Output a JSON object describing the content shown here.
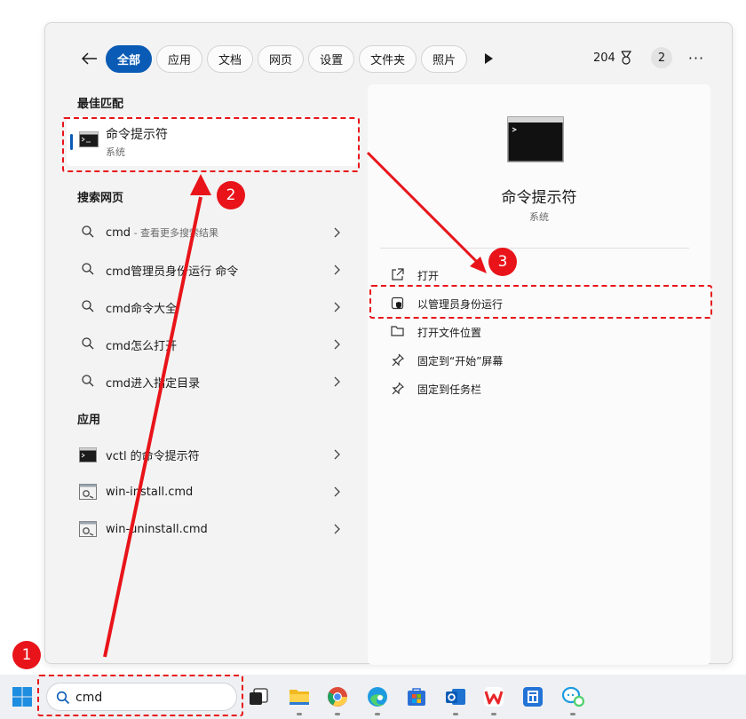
{
  "tabs": [
    "全部",
    "应用",
    "文档",
    "网页",
    "设置",
    "文件夹",
    "照片"
  ],
  "points": "204",
  "badge": "2",
  "more": "···",
  "best_match": {
    "title": "最佳匹配",
    "name": "命令提示符",
    "category": "系统"
  },
  "web_search": {
    "title": "搜索网页",
    "items": [
      {
        "label": "cmd",
        "sub": " - 查看更多搜索结果"
      },
      {
        "label": "cmd管理员身份运行 命令",
        "sub": ""
      },
      {
        "label": "cmd命令大全",
        "sub": ""
      },
      {
        "label": "cmd怎么打开",
        "sub": ""
      },
      {
        "label": "cmd进入指定目录",
        "sub": ""
      }
    ]
  },
  "apps": {
    "title": "应用",
    "items": [
      {
        "label": "vctl 的命令提示符"
      },
      {
        "label": "win-install.cmd"
      },
      {
        "label": "win-uninstall.cmd"
      }
    ]
  },
  "detail": {
    "title": "命令提示符",
    "category": "系统",
    "actions": [
      "打开",
      "以管理员身份运行",
      "打开文件位置",
      "固定到“开始”屏幕",
      "固定到任务栏"
    ]
  },
  "search": {
    "value": "cmd"
  },
  "annotations": [
    "1",
    "2",
    "3"
  ],
  "colors": {
    "accent": "#0a5bb5",
    "annotation": "#e8141a"
  }
}
